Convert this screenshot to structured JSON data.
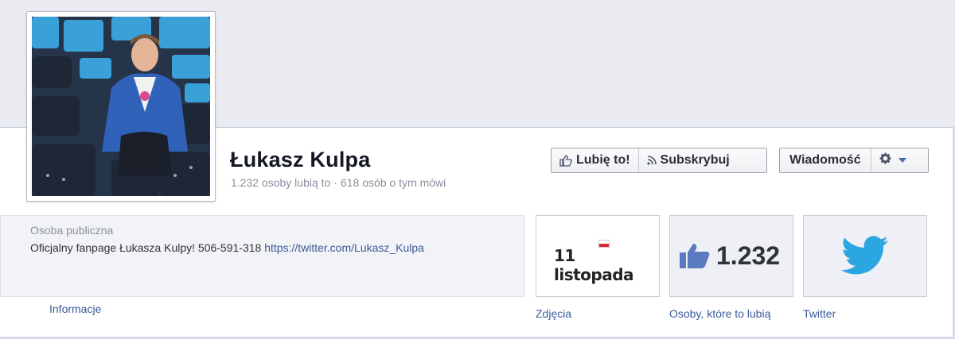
{
  "page": {
    "name": "Łukasz Kulpa",
    "likes_text": "1.232 osoby lubią to",
    "talking_text": "618 osób o tym mówi",
    "stats_separator": "·"
  },
  "actions": {
    "like_label": "Lubię to!",
    "subscribe_label": "Subskrybuj",
    "message_label": "Wiadomość"
  },
  "about": {
    "category": "Osoba publiczna",
    "description": "Oficjalny fanpage Łukasza Kulpy! 506-591-318",
    "link": "https://twitter.com/Lukasz_Kulpa",
    "info_link": "Informacje"
  },
  "tiles": {
    "photos_label": "Zdjęcia",
    "photos_image_text": "11 listopada",
    "likes_count": "1.232",
    "likes_label": "Osoby, które to lubią",
    "twitter_label": "Twitter"
  },
  "colors": {
    "link": "#3b5998",
    "cover": "#e9ebf1",
    "twitter": "#2aa6e0",
    "thumb": "#5b7bc0"
  }
}
